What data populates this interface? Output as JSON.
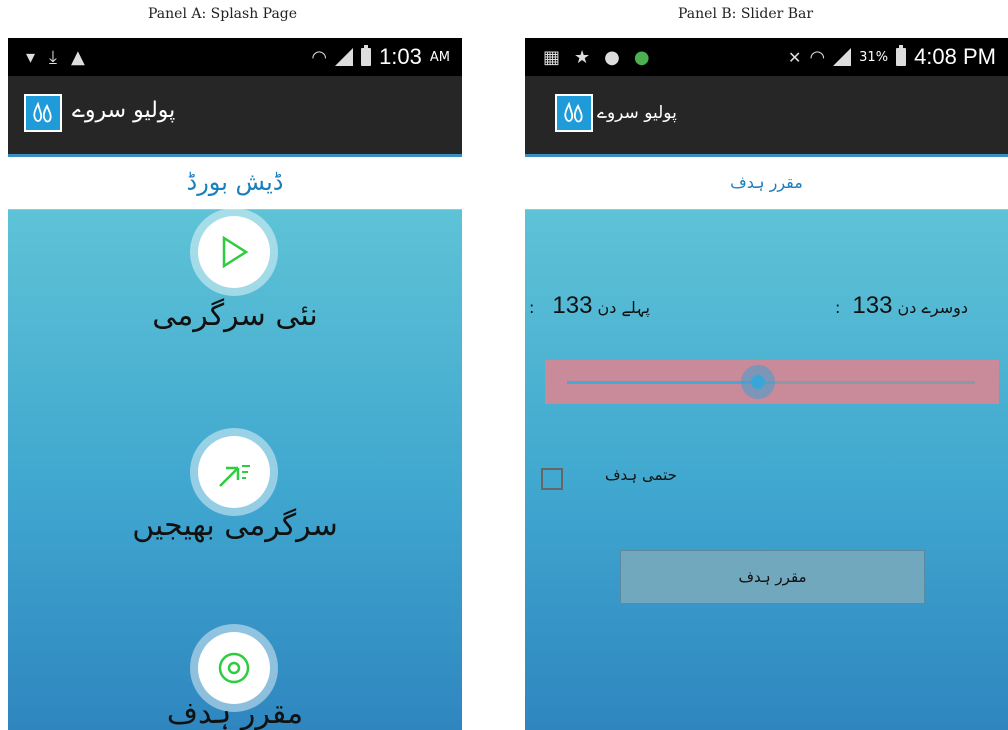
{
  "panel_a": {
    "caption": "Panel A: Splash Page",
    "status": {
      "time": "1:03",
      "ampm": "AM"
    },
    "app_title": "پولیو سروے",
    "subheader": "ڈیش بورڈ",
    "menu": [
      {
        "label": "نئی سرگرمی",
        "icon": "play-icon"
      },
      {
        "label": "سرگرمی بھیجیں",
        "icon": "send-icon"
      },
      {
        "label": "مقرر ہدف",
        "icon": "target-icon"
      }
    ]
  },
  "panel_b": {
    "caption": "Panel B: Slider Bar",
    "status": {
      "time": "4:08 PM",
      "battery": "31%"
    },
    "app_title": "پولیو سروے",
    "subheader": "مقرر ہدف",
    "first_day": {
      "label": ":پہلے دن",
      "value": "133"
    },
    "second_day": {
      "label": ":دوسرے دن",
      "value": "133"
    },
    "slider": {
      "level": 0.45
    },
    "checkbox_label": "حتمی ہدف",
    "button_label": "مقرر ہدف"
  },
  "colors": {
    "accent": "#1a7fbd",
    "actionbar": "#262626",
    "slider_box": "#c98a99",
    "icon_green": "#2ecc40"
  }
}
